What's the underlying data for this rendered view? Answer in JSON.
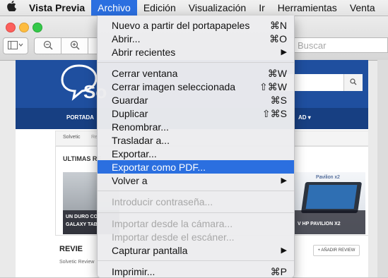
{
  "menubar": {
    "apple_icon": "apple-logo",
    "items": [
      "Vista Previa",
      "Archivo",
      "Edición",
      "Visualización",
      "Ir",
      "Herramientas",
      "Venta"
    ]
  },
  "toolbar": {
    "sidebar_icon": "sidebar-toggle-icon",
    "zoom_out_icon": "zoom-out-icon",
    "zoom_in_icon": "zoom-in-icon",
    "search_placeholder": "Buscar"
  },
  "website": {
    "logo_text": "So",
    "nav_link": "PORTADA",
    "nav_right": "AD ▾",
    "crumb": "Solvetic",
    "crumb2": "Re",
    "section_title": "ULTIMAS RE",
    "card_left_caption_1": "UN DURO CO",
    "card_left_caption_2": "GALAXY TAB",
    "card_right_caption": "V HP PAVILION X2",
    "hp_label": "Pavilion x2",
    "review_title": "REVIE",
    "review_sub": "Solvetic Review",
    "add_review": "+ AÑADIR REVIEW"
  },
  "menu": {
    "items": [
      {
        "label": "Nuevo a partir del portapapeles",
        "shortcut": "⌘N"
      },
      {
        "label": "Abrir...",
        "shortcut": "⌘O"
      },
      {
        "label": "Abrir recientes",
        "shortcut": "▶"
      },
      {
        "label": "Cerrar ventana",
        "shortcut": "⌘W"
      },
      {
        "label": "Cerrar imagen seleccionada",
        "shortcut": "⇧⌘W"
      },
      {
        "label": "Guardar",
        "shortcut": "⌘S"
      },
      {
        "label": "Duplicar",
        "shortcut": "⇧⌘S"
      },
      {
        "label": "Renombrar...",
        "shortcut": ""
      },
      {
        "label": "Trasladar a...",
        "shortcut": ""
      },
      {
        "label": "Exportar...",
        "shortcut": ""
      },
      {
        "label": "Exportar como PDF...",
        "shortcut": ""
      },
      {
        "label": "Volver a",
        "shortcut": "▶"
      },
      {
        "label": "Introducir contraseña...",
        "shortcut": ""
      },
      {
        "label": "Importar desde la cámara...",
        "shortcut": ""
      },
      {
        "label": "Importar desde el escáner...",
        "shortcut": ""
      },
      {
        "label": "Capturar pantalla",
        "shortcut": "▶"
      },
      {
        "label": "Imprimir...",
        "shortcut": "⌘P"
      }
    ]
  },
  "colors": {
    "highlight": "#2b6fe0",
    "site_header": "#1f4f9f"
  }
}
